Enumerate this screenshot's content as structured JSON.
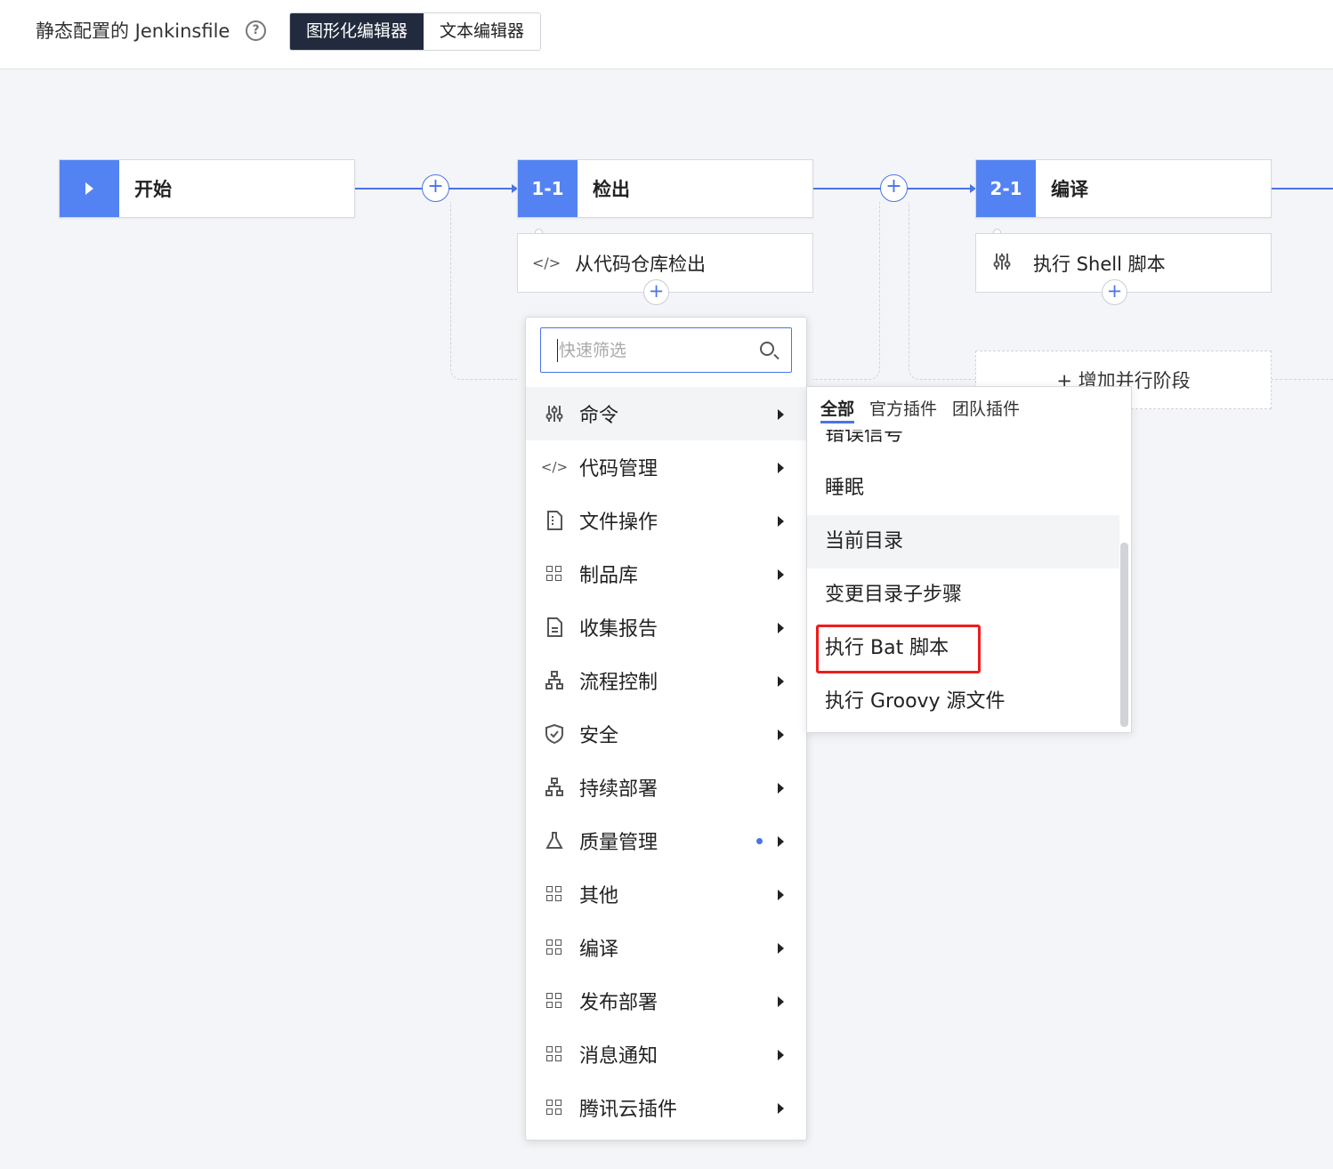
{
  "header": {
    "title": "静态配置的 Jenkinsfile",
    "help_icon": "?",
    "tabs": [
      {
        "label": "图形化编辑器",
        "active": true
      },
      {
        "label": "文本编辑器",
        "active": false
      }
    ]
  },
  "pipeline": {
    "start_stage": {
      "name": "开始",
      "icon": "play-icon"
    },
    "stages": [
      {
        "num": "1-1",
        "name": "检出",
        "step": {
          "icon": "code-icon",
          "label": "从代码仓库检出"
        }
      },
      {
        "num": "2-1",
        "name": "编译",
        "step": {
          "icon": "sliders-icon",
          "label": "执行 Shell 脚本"
        }
      }
    ],
    "add_parallel_label": "+ 增加并行阶段",
    "plus_symbol": "+"
  },
  "step_menu": {
    "search_placeholder": "快速筛选",
    "items": [
      {
        "label": "命令",
        "icon": "sliders-icon"
      },
      {
        "label": "代码管理",
        "icon": "code-icon"
      },
      {
        "label": "文件操作",
        "icon": "file-icon"
      },
      {
        "label": "制品库",
        "icon": "grid-icon"
      },
      {
        "label": "收集报告",
        "icon": "report-icon"
      },
      {
        "label": "流程控制",
        "icon": "hierarchy-icon"
      },
      {
        "label": "安全",
        "icon": "shield-icon"
      },
      {
        "label": "持续部署",
        "icon": "hierarchy-icon"
      },
      {
        "label": "质量管理",
        "icon": "flask-icon",
        "has_dot": true
      },
      {
        "label": "其他",
        "icon": "grid-icon"
      },
      {
        "label": "编译",
        "icon": "grid-icon"
      },
      {
        "label": "发布部署",
        "icon": "grid-icon"
      },
      {
        "label": "消息通知",
        "icon": "grid-icon"
      },
      {
        "label": "腾讯云插件",
        "icon": "grid-icon"
      }
    ]
  },
  "submenu": {
    "tabs": [
      {
        "label": "全部",
        "active": true
      },
      {
        "label": "官方插件",
        "active": false
      },
      {
        "label": "团队插件",
        "active": false
      }
    ],
    "items": [
      {
        "label": "错误信号"
      },
      {
        "label": "睡眠"
      },
      {
        "label": "当前目录"
      },
      {
        "label": "变更目录子步骤"
      },
      {
        "label": "执行 Bat 脚本"
      },
      {
        "label": "执行 Groovy 源文件"
      }
    ]
  },
  "colors": {
    "accent": "#5383f3",
    "link": "#4a74e8",
    "dark": "#222b3d",
    "highlight": "#ee1c1c"
  }
}
